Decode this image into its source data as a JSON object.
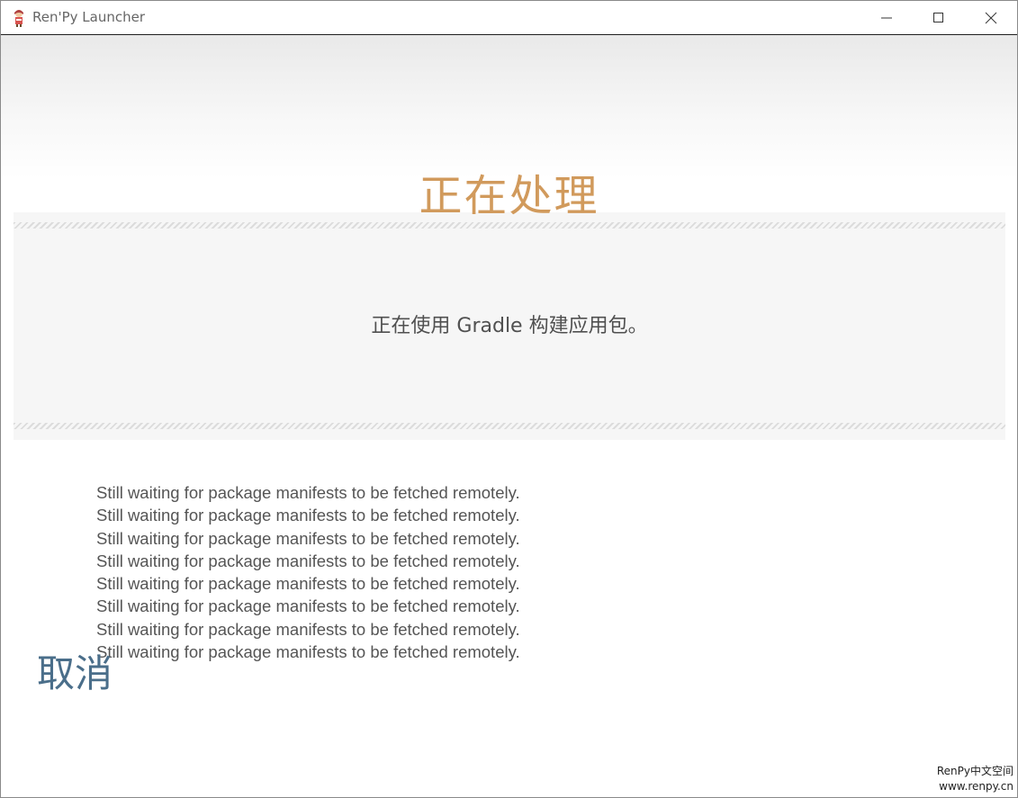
{
  "window": {
    "title": "Ren'Py Launcher",
    "icon": "renpy-eileen-icon"
  },
  "controls": {
    "minimize_icon": "minimize-icon",
    "maximize_icon": "maximize-icon",
    "close_icon": "close-icon"
  },
  "main": {
    "heading": "正在处理",
    "message": "正在使用 Gradle 构建应用包。",
    "log_lines": [
      "Still waiting for package manifests to be fetched remotely.",
      "Still waiting for package manifests to be fetched remotely.",
      "Still waiting for package manifests to be fetched remotely.",
      "Still waiting for package manifests to be fetched remotely.",
      "Still waiting for package manifests to be fetched remotely.",
      "Still waiting for package manifests to be fetched remotely.",
      "Still waiting for package manifests to be fetched remotely.",
      "Still waiting for package manifests to be fetched remotely."
    ],
    "cancel_label": "取消"
  },
  "watermark": {
    "line1": "RenPy中文空间",
    "line2": "www.renpy.cn"
  },
  "colors": {
    "heading": "#d19a5c",
    "cancel": "#4a6e8a",
    "message": "#505050",
    "log": "#555555"
  }
}
